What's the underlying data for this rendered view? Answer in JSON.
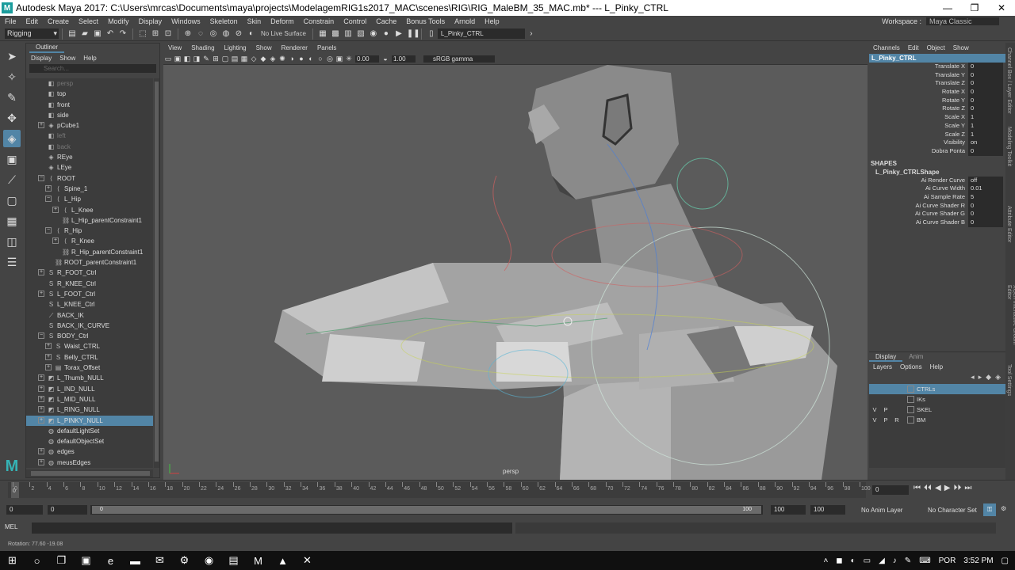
{
  "window": {
    "title": "Autodesk Maya 2017: C:\\Users\\mrcas\\Documents\\maya\\projects\\ModelagemRIG1s2017_MAC\\scenes\\RIG\\RIG_MaleBM_35_MAC.mb*   ---   L_Pinky_CTRL",
    "app_icon": "maya-icon",
    "controls": [
      "—",
      "❐",
      "✕"
    ]
  },
  "menubar": {
    "items": [
      "File",
      "Edit",
      "Create",
      "Select",
      "Modify",
      "Display",
      "Windows",
      "Skeleton",
      "Skin",
      "Deform",
      "Constrain",
      "Control",
      "Cache",
      "Bonus Tools",
      "Arnold",
      "Help"
    ],
    "workspace_label": "Workspace :",
    "workspace_value": "Maya Classic"
  },
  "shelf": {
    "mode": "Rigging",
    "live_surface": "No Live Surface",
    "selection_field": "L_Pinky_CTRL"
  },
  "outliner": {
    "tab": "Outliner",
    "menu": [
      "Display",
      "Show",
      "Help"
    ],
    "search_placeholder": "Search...",
    "rows": [
      {
        "label": "persp",
        "indent": 1,
        "dim": true,
        "icon": "camera"
      },
      {
        "label": "top",
        "indent": 1,
        "icon": "camera"
      },
      {
        "label": "front",
        "indent": 1,
        "icon": "camera"
      },
      {
        "label": "side",
        "indent": 1,
        "icon": "camera"
      },
      {
        "label": "pCube1",
        "indent": 1,
        "icon": "mesh",
        "exp": "+"
      },
      {
        "label": "left",
        "indent": 1,
        "dim": true,
        "icon": "camera"
      },
      {
        "label": "back",
        "indent": 1,
        "dim": true,
        "icon": "camera"
      },
      {
        "label": "REye",
        "indent": 1,
        "icon": "mesh"
      },
      {
        "label": "LEye",
        "indent": 1,
        "icon": "mesh"
      },
      {
        "label": "ROOT",
        "indent": 1,
        "icon": "joint",
        "exp": "−"
      },
      {
        "label": "Spine_1",
        "indent": 2,
        "icon": "joint",
        "exp": "+"
      },
      {
        "label": "L_Hip",
        "indent": 2,
        "icon": "joint",
        "exp": "−"
      },
      {
        "label": "L_Knee",
        "indent": 3,
        "icon": "joint",
        "exp": "+"
      },
      {
        "label": "L_Hip_parentConstraint1",
        "indent": 3,
        "icon": "constraint"
      },
      {
        "label": "R_Hip",
        "indent": 2,
        "icon": "joint",
        "exp": "−"
      },
      {
        "label": "R_Knee",
        "indent": 3,
        "icon": "joint",
        "exp": "+"
      },
      {
        "label": "R_Hip_parentConstraint1",
        "indent": 3,
        "icon": "constraint"
      },
      {
        "label": "ROOT_parentConstraint1",
        "indent": 2,
        "icon": "constraint"
      },
      {
        "label": "R_FOOT_Ctrl",
        "indent": 1,
        "icon": "curve",
        "exp": "+"
      },
      {
        "label": "R_KNEE_Ctrl",
        "indent": 1,
        "icon": "curve"
      },
      {
        "label": "L_FOOT_Ctrl",
        "indent": 1,
        "icon": "curve",
        "exp": "+"
      },
      {
        "label": "L_KNEE_Ctrl",
        "indent": 1,
        "icon": "curve"
      },
      {
        "label": "BACK_IK",
        "indent": 1,
        "icon": "ik"
      },
      {
        "label": "BACK_IK_CURVE",
        "indent": 1,
        "icon": "curve"
      },
      {
        "label": "BODY_Ctrl",
        "indent": 1,
        "icon": "curve",
        "exp": "−"
      },
      {
        "label": "Waist_CTRL",
        "indent": 2,
        "icon": "curve",
        "exp": "+"
      },
      {
        "label": "Belly_CTRL",
        "indent": 2,
        "icon": "curve",
        "exp": "+"
      },
      {
        "label": "Torax_Offset",
        "indent": 2,
        "icon": "group",
        "exp": "+"
      },
      {
        "label": "L_Thumb_NULL",
        "indent": 1,
        "icon": "null",
        "exp": "+"
      },
      {
        "label": "L_IND_NULL",
        "indent": 1,
        "icon": "null",
        "exp": "+"
      },
      {
        "label": "L_MID_NULL",
        "indent": 1,
        "icon": "null",
        "exp": "+"
      },
      {
        "label": "L_RING_NULL",
        "indent": 1,
        "icon": "null",
        "exp": "+"
      },
      {
        "label": "L_PINKY_NULL",
        "indent": 1,
        "icon": "null",
        "exp": "+",
        "selected": true
      },
      {
        "label": "defaultLightSet",
        "indent": 1,
        "icon": "set"
      },
      {
        "label": "defaultObjectSet",
        "indent": 1,
        "icon": "set"
      },
      {
        "label": "edges",
        "indent": 1,
        "icon": "set",
        "exp": "+"
      },
      {
        "label": "meusEdges",
        "indent": 1,
        "icon": "set",
        "exp": "+"
      }
    ]
  },
  "viewport": {
    "menu": [
      "View",
      "Shading",
      "Lighting",
      "Show",
      "Renderer",
      "Panels"
    ],
    "exposure": "0.00",
    "gamma": "1.00",
    "color_space": "sRGB gamma",
    "camera_label": "persp"
  },
  "channel_box": {
    "menu": [
      "Channels",
      "Edit",
      "Object",
      "Show"
    ],
    "node": "L_Pinky_CTRL",
    "attributes": [
      {
        "label": "Translate X",
        "value": "0"
      },
      {
        "label": "Translate Y",
        "value": "0"
      },
      {
        "label": "Translate Z",
        "value": "0"
      },
      {
        "label": "Rotate X",
        "value": "0"
      },
      {
        "label": "Rotate Y",
        "value": "0"
      },
      {
        "label": "Rotate Z",
        "value": "0"
      },
      {
        "label": "Scale X",
        "value": "1"
      },
      {
        "label": "Scale Y",
        "value": "1"
      },
      {
        "label": "Scale Z",
        "value": "1"
      },
      {
        "label": "Visibility",
        "value": "on"
      },
      {
        "label": "Dobra Ponta",
        "value": "0"
      }
    ],
    "shapes_header": "SHAPES",
    "shape_node": "L_Pinky_CTRLShape",
    "shape_attributes": [
      {
        "label": "Ai Render Curve",
        "value": "off"
      },
      {
        "label": "Ai Curve Width",
        "value": "0.01"
      },
      {
        "label": "Ai Sample Rate",
        "value": "5"
      },
      {
        "label": "Ai Curve Shader R",
        "value": "0"
      },
      {
        "label": "Ai Curve Shader G",
        "value": "0"
      },
      {
        "label": "Ai Curve Shader B",
        "value": "0"
      }
    ]
  },
  "side_tabs": [
    "Channel Box / Layer Editor",
    "Modeling Toolkit",
    "Attribute Editor",
    "XGen Interactive Groom Editor",
    "Tool Settings"
  ],
  "layers": {
    "tabs": [
      "Display",
      "Anim"
    ],
    "menu": [
      "Layers",
      "Options",
      "Help"
    ],
    "rows": [
      {
        "v": "",
        "p": "",
        "r": "",
        "name": "CTRLs",
        "selected": true
      },
      {
        "v": "",
        "p": "",
        "r": "",
        "name": "IKs"
      },
      {
        "v": "V",
        "p": "P",
        "r": "",
        "name": "SKEL"
      },
      {
        "v": "V",
        "p": "P",
        "r": "R",
        "name": "BM"
      }
    ]
  },
  "timeline": {
    "ticks": [
      0,
      2,
      4,
      6,
      8,
      10,
      12,
      14,
      16,
      18,
      20,
      22,
      24,
      26,
      28,
      30,
      32,
      34,
      36,
      38,
      40,
      42,
      44,
      46,
      48,
      50,
      52,
      54,
      56,
      58,
      60,
      62,
      64,
      66,
      68,
      70,
      72,
      74,
      76,
      78,
      80,
      82,
      84,
      86,
      88,
      90,
      92,
      94,
      96,
      98,
      100
    ],
    "current_frame": "0",
    "current_field": "0",
    "playback": [
      "⏮",
      "⏴⏴",
      "◀",
      "▶",
      "⏵⏵",
      "⏭"
    ]
  },
  "range": {
    "start": "0",
    "anim_start": "0",
    "slider_start": "0",
    "slider_end": "100",
    "end": "100",
    "anim_end": "100",
    "anim_layer": "No Anim Layer",
    "character_set": "No Character Set"
  },
  "commandline": {
    "label": "MEL"
  },
  "helpline": {
    "text": "Rotation:  77.60    -19.08"
  },
  "taskbar": {
    "language": "POR",
    "time": "3:52 PM"
  },
  "colors": {
    "accent": "#5285a6",
    "panel": "#444444",
    "field": "#2b2b2b"
  }
}
